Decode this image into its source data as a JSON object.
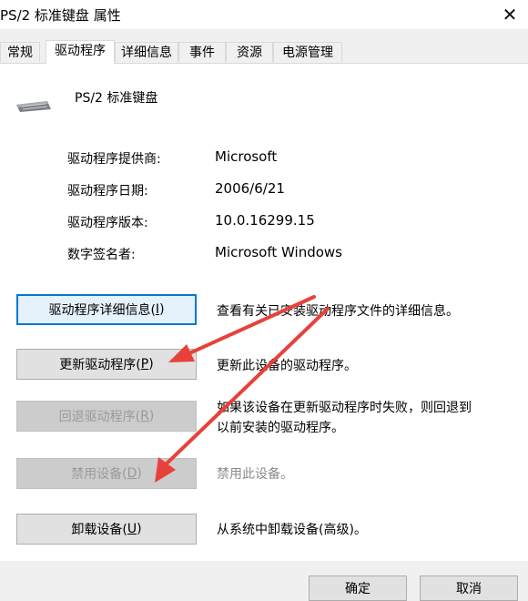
{
  "window": {
    "title": "PS/2 标准键盘 属性",
    "close_glyph": "✕"
  },
  "tabs": [
    {
      "label": "常规",
      "active": false
    },
    {
      "label": "驱动程序",
      "active": true
    },
    {
      "label": "详细信息",
      "active": false
    },
    {
      "label": "事件",
      "active": false
    },
    {
      "label": "资源",
      "active": false
    },
    {
      "label": "电源管理",
      "active": false
    }
  ],
  "device": {
    "name": "PS/2 标准键盘",
    "icon": "keyboard-icon"
  },
  "driver_info": [
    {
      "label": "驱动程序提供商:",
      "value": "Microsoft"
    },
    {
      "label": "驱动程序日期:",
      "value": "2006/6/21"
    },
    {
      "label": "驱动程序版本:",
      "value": "10.0.16299.15"
    },
    {
      "label": "数字签名者:",
      "value": "Microsoft Windows"
    }
  ],
  "actions": [
    {
      "pre": "驱动程序详细信息(",
      "key": "I",
      "post": ")",
      "enabled": true,
      "focused": true,
      "desc": "查看有关已安装驱动程序文件的详细信息。"
    },
    {
      "pre": "更新驱动程序(",
      "key": "P",
      "post": ")",
      "enabled": true,
      "focused": false,
      "desc": "更新此设备的驱动程序。"
    },
    {
      "pre": "回退驱动程序(",
      "key": "R",
      "post": ")",
      "enabled": false,
      "focused": false,
      "desc_line1": "如果该设备在更新驱动程序时失败，则回退到",
      "desc_line2": "以前安装的驱动程序。"
    },
    {
      "pre": "禁用设备(",
      "key": "D",
      "post": ")",
      "enabled": false,
      "focused": false,
      "desc": "禁用此设备。"
    },
    {
      "pre": "卸载设备(",
      "key": "U",
      "post": ")",
      "enabled": true,
      "focused": false,
      "desc": "从系统中卸载设备(高级)。"
    }
  ],
  "footer": {
    "ok": "确定",
    "cancel": "取消"
  },
  "colors": {
    "annotation_arrow": "#e8413b",
    "focus_border": "#0078d7"
  }
}
